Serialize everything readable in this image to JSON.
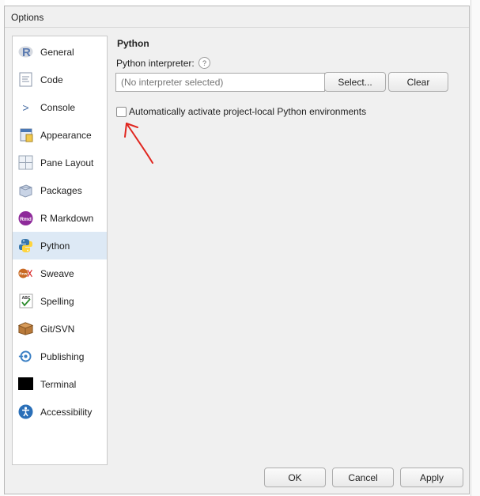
{
  "dialog": {
    "title": "Options"
  },
  "sidebar": {
    "items": [
      {
        "label": "General",
        "icon": "r-logo-icon"
      },
      {
        "label": "Code",
        "icon": "code-icon"
      },
      {
        "label": "Console",
        "icon": "console-icon"
      },
      {
        "label": "Appearance",
        "icon": "appearance-icon"
      },
      {
        "label": "Pane Layout",
        "icon": "pane-layout-icon"
      },
      {
        "label": "Packages",
        "icon": "packages-icon"
      },
      {
        "label": "R Markdown",
        "icon": "rmarkdown-icon"
      },
      {
        "label": "Python",
        "icon": "python-icon",
        "selected": true
      },
      {
        "label": "Sweave",
        "icon": "sweave-icon"
      },
      {
        "label": "Spelling",
        "icon": "spelling-icon"
      },
      {
        "label": "Git/SVN",
        "icon": "git-icon"
      },
      {
        "label": "Publishing",
        "icon": "publishing-icon"
      },
      {
        "label": "Terminal",
        "icon": "terminal-icon"
      },
      {
        "label": "Accessibility",
        "icon": "accessibility-icon"
      }
    ]
  },
  "python": {
    "section_title": "Python",
    "interpreter_label": "Python interpreter:",
    "help_glyph": "?",
    "interpreter_placeholder": "(No interpreter selected)",
    "interpreter_value": "",
    "select_label": "Select...",
    "clear_label": "Clear",
    "auto_activate_label": "Automatically activate project-local Python environments",
    "auto_activate_checked": false
  },
  "footer": {
    "ok_label": "OK",
    "cancel_label": "Cancel",
    "apply_label": "Apply"
  },
  "icon_glyphs": {
    "rmarkdown": "Rmd",
    "sweave": "Rnw",
    "spelling": "ABC",
    "console": ">"
  },
  "colors": {
    "selected_bg": "#dde9f5",
    "annotation": "#e0261f"
  }
}
